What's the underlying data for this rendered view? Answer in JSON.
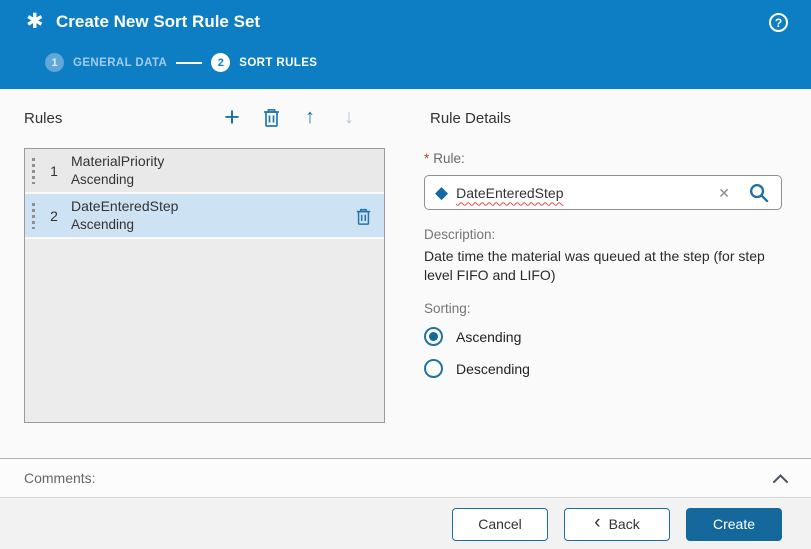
{
  "header": {
    "title": "Create New Sort Rule Set"
  },
  "stepper": {
    "steps": [
      {
        "number": "1",
        "label": "GENERAL DATA"
      },
      {
        "number": "2",
        "label": "SORT RULES"
      }
    ]
  },
  "rules_panel": {
    "title": "Rules",
    "rows": [
      {
        "index": "1",
        "name": "MaterialPriority",
        "sort": "Ascending"
      },
      {
        "index": "2",
        "name": "DateEnteredStep",
        "sort": "Ascending"
      }
    ],
    "selected_row_index": "2"
  },
  "details": {
    "title": "Rule Details",
    "required_marker": "*",
    "rule_label": "Rule:",
    "rule_value": "DateEnteredStep",
    "description_label": "Description:",
    "description_text": "Date time the material was queued at the step (for step level FIFO and LIFO)",
    "sorting_label": "Sorting:",
    "sorting_options": [
      {
        "label": "Ascending",
        "selected": true
      },
      {
        "label": "Descending",
        "selected": false
      }
    ]
  },
  "comments": {
    "label": "Comments:"
  },
  "footer": {
    "cancel_label": "Cancel",
    "back_label": "Back",
    "create_label": "Create"
  },
  "icons": {
    "app": "✱",
    "help": "?",
    "add": "+",
    "move_up": "↑",
    "move_down": "↓",
    "diamond": "◆",
    "clear": "✕",
    "back_chevron": "‹"
  },
  "colors": {
    "header_bg": "#0d7ec3",
    "accent": "#1c6ea6",
    "primary_button_bg": "#15689c",
    "selected_row_bg": "#cde2f3",
    "panel_bg": "#ececec",
    "required_marker": "#c0392b",
    "spellcheck_underline": "#dd4b4b"
  }
}
